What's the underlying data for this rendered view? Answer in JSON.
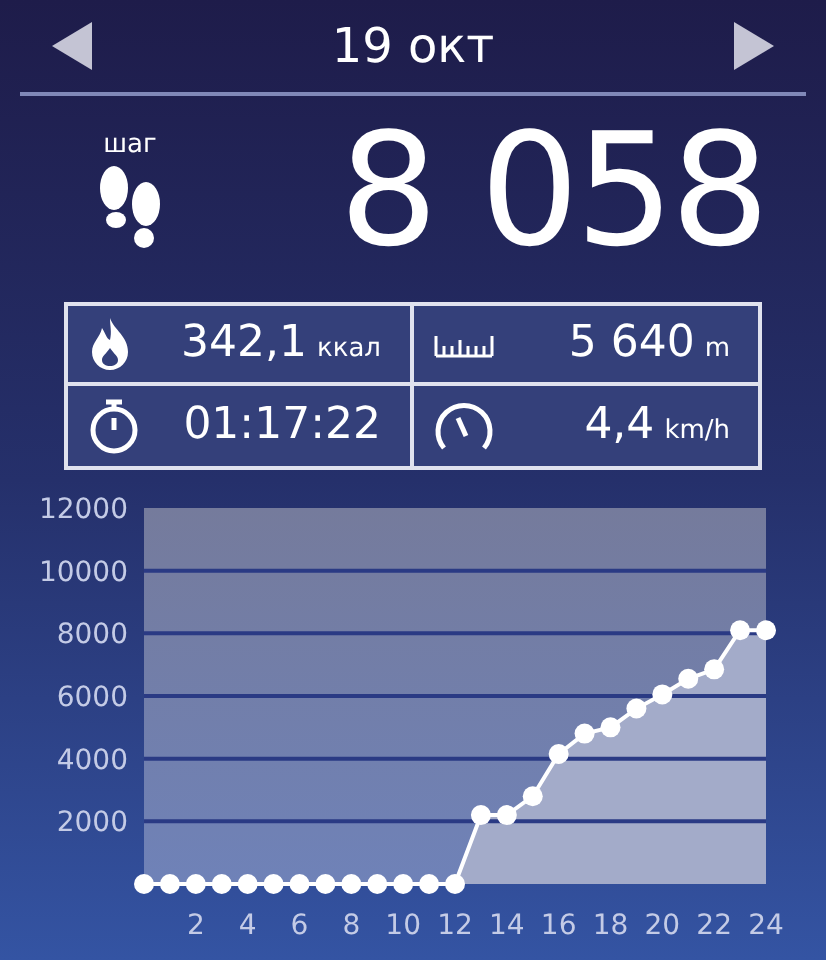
{
  "header": {
    "date": "19 окт"
  },
  "steps": {
    "label": "шаг",
    "value": "8 058"
  },
  "stats": [
    {
      "kind": "calories",
      "value": "342,1",
      "unit": "ккал"
    },
    {
      "kind": "distance",
      "value": "5 640",
      "unit": "m"
    },
    {
      "kind": "duration",
      "value": "01:17:22"
    },
    {
      "kind": "speed",
      "value": "4,4",
      "unit": "km/h"
    }
  ],
  "chart": {
    "chart_data": {
      "type": "area",
      "x": [
        0,
        1,
        2,
        3,
        4,
        5,
        6,
        7,
        8,
        9,
        10,
        11,
        12,
        13,
        14,
        15,
        16,
        17,
        18,
        19,
        20,
        21,
        22,
        23,
        24
      ],
      "grid": true,
      "series": [
        {
          "color": "#ffffff",
          "values": [
            0,
            0,
            0,
            0,
            0,
            0,
            0,
            0,
            0,
            0,
            0,
            0,
            0,
            2200,
            2200,
            2800,
            4150,
            4800,
            5000,
            5600,
            6050,
            6550,
            6850,
            8100,
            8100
          ]
        }
      ],
      "xlim": [
        0,
        24
      ],
      "ylim": [
        0,
        12000
      ],
      "xticks": [
        2,
        4,
        6,
        8,
        10,
        12,
        14,
        16,
        18,
        20,
        22,
        24
      ],
      "yticks": [
        2000,
        4000,
        6000,
        8000,
        10000,
        12000
      ]
    }
  }
}
